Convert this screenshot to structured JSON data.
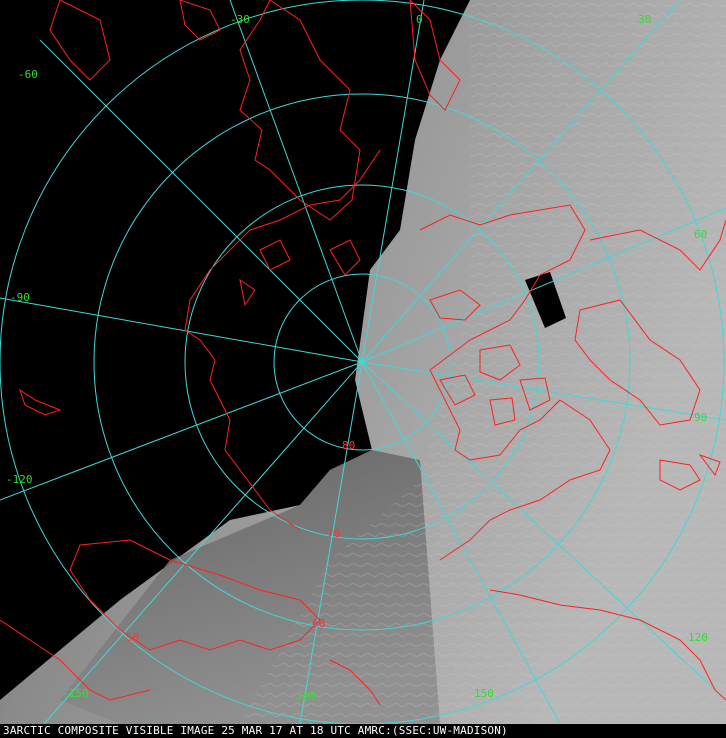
{
  "caption": {
    "frame_number": "3",
    "text": "ARCTIC COMPOSITE VISIBLE IMAGE 25 MAR 17 AT 18 UTC AMRC:(SSEC:UW-MADISON)"
  },
  "colors": {
    "graticule": "#40d8d8",
    "coastline": "#ff2020",
    "longitude_label": "#33dd33",
    "latitude_label": "#ff3333",
    "night_side": "#000000",
    "day_side": "#9a9a9a"
  },
  "longitude_labels": [
    "-30",
    "0",
    "30",
    "-60",
    "60",
    "-90",
    "90",
    "-120",
    "120",
    "-150",
    "150",
    "180"
  ],
  "latitude_labels": [
    "80",
    "70",
    "60",
    "50"
  ]
}
